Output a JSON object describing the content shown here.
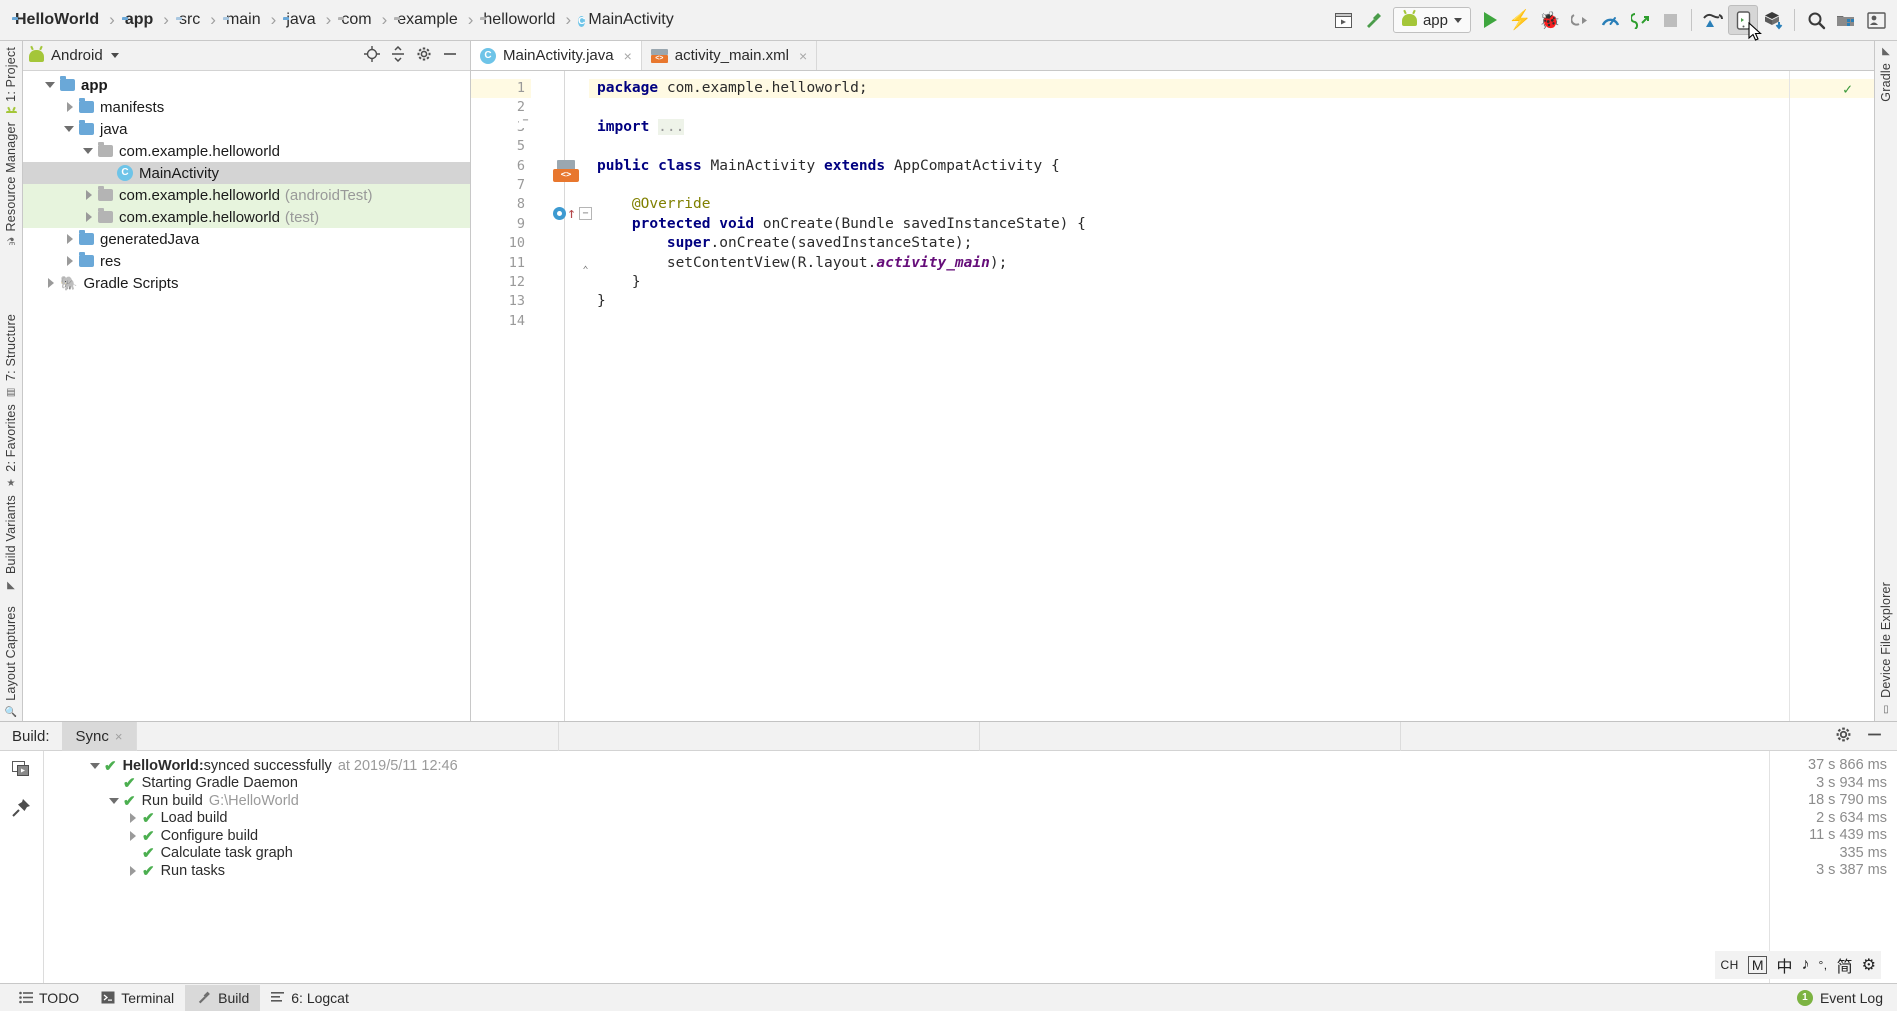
{
  "breadcrumbs": [
    {
      "label": "HelloWorld",
      "icon": "project-icon",
      "bold": true
    },
    {
      "label": "app",
      "icon": "module-folder-icon",
      "bold": true
    },
    {
      "label": "src",
      "icon": "folder-icon",
      "bold": false
    },
    {
      "label": "main",
      "icon": "folder-icon",
      "bold": false
    },
    {
      "label": "java",
      "icon": "folder-blue-icon",
      "bold": false
    },
    {
      "label": "com",
      "icon": "package-icon",
      "bold": false
    },
    {
      "label": "example",
      "icon": "package-icon",
      "bold": false
    },
    {
      "label": "helloworld",
      "icon": "package-icon",
      "bold": false
    },
    {
      "label": "MainActivity",
      "icon": "class-icon",
      "bold": false
    }
  ],
  "breadcrumb_separator": "›",
  "toolbar": {
    "run_config_label": "app",
    "buttons": [
      {
        "name": "avd-manager-button",
        "title": "AVD Manager"
      },
      {
        "name": "make-project-button",
        "title": "Make Project"
      },
      {
        "name": "run-button",
        "title": "Run"
      },
      {
        "name": "apply-changes-button",
        "title": "Apply Changes"
      },
      {
        "name": "debug-button",
        "title": "Debug"
      },
      {
        "name": "attach-debugger-button",
        "title": "Attach Debugger"
      },
      {
        "name": "profiler-button",
        "title": "Profiler"
      },
      {
        "name": "run-with-coverage-button",
        "title": "Run with Coverage"
      },
      {
        "name": "stop-button",
        "title": "Stop"
      },
      {
        "name": "sync-gradle-button",
        "title": "Sync Project with Gradle Files"
      },
      {
        "name": "avd-device-manager-button",
        "title": "AVD Manager",
        "selected": true
      },
      {
        "name": "sdk-manager-button",
        "title": "SDK Manager"
      },
      {
        "name": "search-everywhere-button",
        "title": "Search Everywhere"
      },
      {
        "name": "project-structure-button",
        "title": "Project Structure"
      },
      {
        "name": "settings-button",
        "title": "Settings"
      }
    ]
  },
  "left_rail": [
    {
      "label": "1: Project",
      "selected": true
    },
    {
      "label": "Resource Manager",
      "selected": false
    },
    {
      "label": "7: Structure",
      "selected": false
    },
    {
      "label": "2: Favorites",
      "selected": false
    },
    {
      "label": "Build Variants",
      "selected": false
    },
    {
      "label": "Layout Captures",
      "selected": false
    }
  ],
  "right_rail": [
    {
      "label": "Gradle"
    },
    {
      "label": "Device File Explorer"
    }
  ],
  "project_panel": {
    "view_selector": "Android",
    "header_actions": [
      "locate-icon",
      "collapse-all-icon",
      "settings-icon",
      "hide-icon"
    ],
    "tree": [
      {
        "label": "app",
        "indent": 0,
        "arrow": "open",
        "icon": "module-folder-icon",
        "bold": true,
        "suffix": "",
        "state": "normal"
      },
      {
        "label": "manifests",
        "indent": 1,
        "arrow": "closed",
        "icon": "folder-blue-icon",
        "bold": false,
        "suffix": "",
        "state": "normal"
      },
      {
        "label": "java",
        "indent": 1,
        "arrow": "open",
        "icon": "folder-blue-icon",
        "bold": false,
        "suffix": "",
        "state": "normal"
      },
      {
        "label": "com.example.helloworld",
        "indent": 2,
        "arrow": "open",
        "icon": "package-icon",
        "bold": false,
        "suffix": "",
        "state": "normal"
      },
      {
        "label": "MainActivity",
        "indent": 3,
        "arrow": "none",
        "icon": "class-icon",
        "bold": false,
        "suffix": "",
        "state": "selected"
      },
      {
        "label": "com.example.helloworld",
        "indent": 2,
        "arrow": "closed",
        "icon": "package-icon",
        "bold": false,
        "suffix": "(androidTest)",
        "state": "green"
      },
      {
        "label": "com.example.helloworld",
        "indent": 2,
        "arrow": "closed",
        "icon": "package-icon",
        "bold": false,
        "suffix": "(test)",
        "state": "green"
      },
      {
        "label": "generatedJava",
        "indent": 1,
        "arrow": "closed",
        "icon": "generated-folder-icon",
        "bold": false,
        "suffix": "",
        "state": "normal"
      },
      {
        "label": "res",
        "indent": 1,
        "arrow": "closed",
        "icon": "res-folder-icon",
        "bold": false,
        "suffix": "",
        "state": "normal"
      },
      {
        "label": "Gradle Scripts",
        "indent": 0,
        "arrow": "closed",
        "icon": "gradle-icon",
        "bold": false,
        "suffix": "",
        "state": "normal"
      }
    ]
  },
  "editor": {
    "tabs": [
      {
        "label": "MainActivity.java",
        "icon": "class-icon",
        "active": true,
        "close": "×"
      },
      {
        "label": "activity_main.xml",
        "icon": "xml-layout-icon",
        "active": false,
        "close": "×"
      }
    ],
    "inspection_status": "✓",
    "lines": [
      {
        "num": "1",
        "highlight": true,
        "html": "<span class='kw'>package</span> com.example.helloworld;"
      },
      {
        "num": "2",
        "highlight": false,
        "html": ""
      },
      {
        "num": "3",
        "highlight": false,
        "html": "<span class='kw'>import</span> <span class='fld-txt'>...</span>"
      },
      {
        "num": "5",
        "highlight": false,
        "html": ""
      },
      {
        "num": "6",
        "highlight": false,
        "html": "<span class='kw'>public class</span> MainActivity <span class='kw'>extends</span> AppCompatActivity {"
      },
      {
        "num": "7",
        "highlight": false,
        "html": ""
      },
      {
        "num": "8",
        "highlight": false,
        "html": "    <span class='ann'>@Override</span>"
      },
      {
        "num": "9",
        "highlight": false,
        "html": "    <span class='kw'>protected void</span> onCreate(Bundle savedInstanceState) {"
      },
      {
        "num": "10",
        "highlight": false,
        "html": "        <span class='kw'>super</span>.onCreate(savedInstanceState);"
      },
      {
        "num": "11",
        "highlight": false,
        "html": "        setContentView(R.layout.<span class='fieldit'>activity_main</span>);"
      },
      {
        "num": "12",
        "highlight": false,
        "html": "    }"
      },
      {
        "num": "13",
        "highlight": false,
        "html": "}"
      },
      {
        "num": "14",
        "highlight": false,
        "html": ""
      }
    ]
  },
  "build_panel": {
    "label": "Build:",
    "tab": "Sync",
    "tab_close": "×",
    "actions": [
      "settings-icon",
      "hide-icon"
    ],
    "side_actions": [
      "restart-icon",
      "pin-icon"
    ],
    "rows": [
      {
        "indent": 0,
        "arrow": "open",
        "name": "HelloWorld:",
        "text": " synced successfully",
        "dim": "at 2019/5/11 12:46",
        "time": "37 s 866 ms"
      },
      {
        "indent": 1,
        "arrow": "none",
        "name": "",
        "text": "Starting Gradle Daemon",
        "dim": "",
        "time": "3 s 934 ms"
      },
      {
        "indent": 1,
        "arrow": "open",
        "name": "",
        "text": "Run build",
        "dim": "G:\\HelloWorld",
        "time": "18 s 790 ms"
      },
      {
        "indent": 2,
        "arrow": "closed",
        "name": "",
        "text": "Load build",
        "dim": "",
        "time": "2 s 634 ms"
      },
      {
        "indent": 2,
        "arrow": "closed",
        "name": "",
        "text": "Configure build",
        "dim": "",
        "time": "11 s 439 ms"
      },
      {
        "indent": 2,
        "arrow": "none",
        "name": "",
        "text": "Calculate task graph",
        "dim": "",
        "time": "335 ms"
      },
      {
        "indent": 2,
        "arrow": "closed",
        "name": "",
        "text": "Run tasks",
        "dim": "",
        "time": "3 s 387 ms"
      }
    ]
  },
  "status_bar": {
    "tools": [
      {
        "label": "TODO",
        "icon": "todo-icon",
        "active": false,
        "mnemonic": ""
      },
      {
        "label": "Terminal",
        "icon": "terminal-icon",
        "active": false,
        "mnemonic": ""
      },
      {
        "label": "Build",
        "icon": "build-hammer-icon",
        "active": true,
        "mnemonic": ""
      },
      {
        "label": "6: Logcat",
        "icon": "logcat-icon",
        "active": false,
        "mnemonic": "6"
      }
    ],
    "event_log": {
      "label": "Event Log",
      "count": "1"
    }
  },
  "ime_bar": {
    "items": [
      "CH",
      "M",
      "中",
      "♪",
      "°,",
      "简",
      "⚙"
    ]
  },
  "colors": {
    "accent_green": "#3ea63e",
    "selection_gray": "#d4d4d4",
    "test_green": "#e7f4dd",
    "line_highlight": "#fffae3",
    "keyword_blue": "#000080",
    "field_purple": "#660e7a"
  }
}
